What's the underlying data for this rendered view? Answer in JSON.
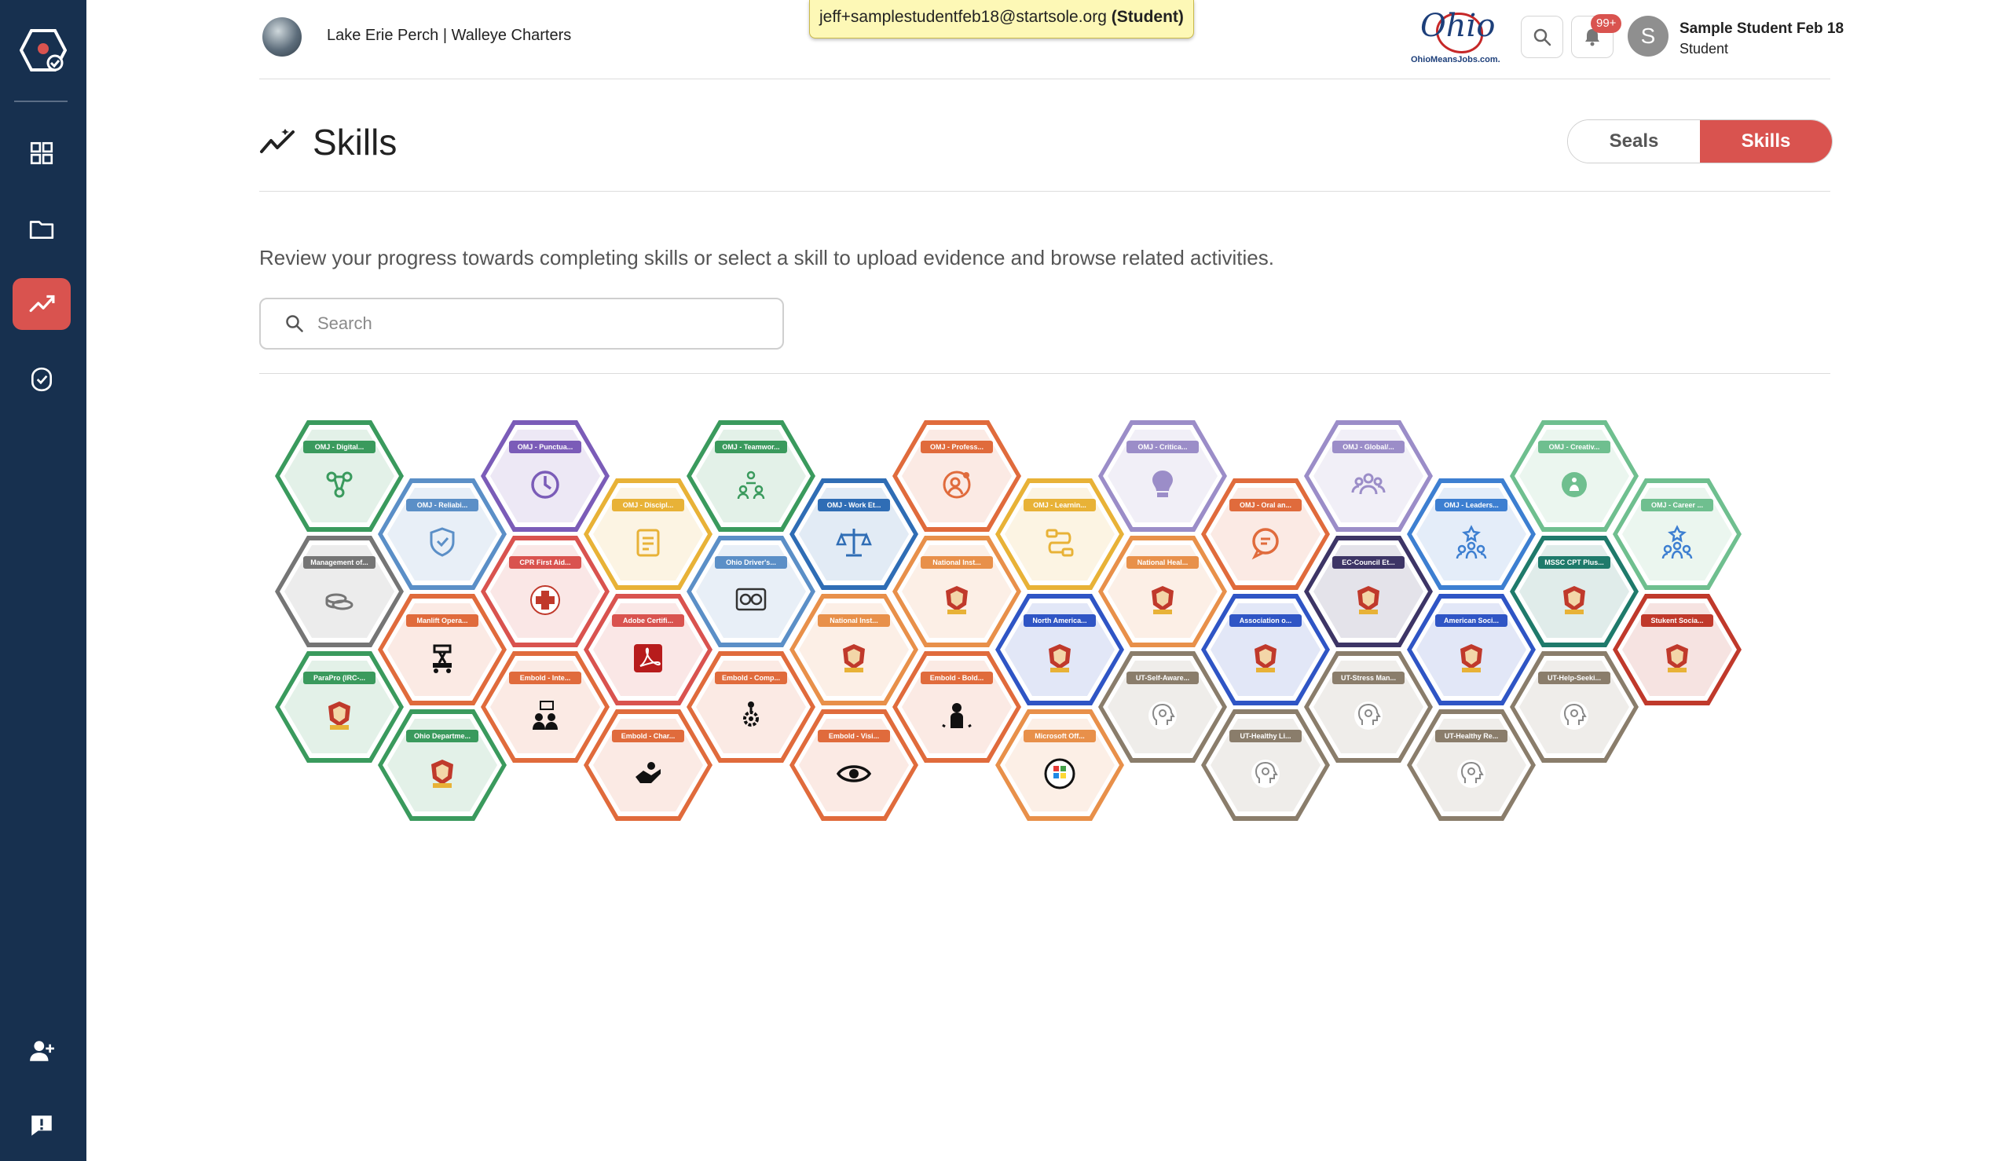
{
  "header": {
    "org_name": "Lake Erie Perch | Walleye Charters",
    "impersonation_email": "jeff+samplestudentfeb18@startsole.org",
    "impersonation_role": "(Student)",
    "ohio_logo_script": "Ohio",
    "ohio_logo_tagline": "OhioMeansJobs.com.",
    "notification_count": "99+",
    "user_initial": "S",
    "user_name": "Sample Student Feb 18",
    "user_role": "Student"
  },
  "page": {
    "title": "Skills",
    "toggle": {
      "seals_label": "Seals",
      "skills_label": "Skills",
      "active": "Skills"
    },
    "intro": "Review your progress towards completing skills or select a skill to upload evidence and browse related activities.",
    "search": {
      "placeholder": "Search",
      "value": ""
    }
  },
  "colors": {
    "accent": "#d9534f",
    "sidebar": "#17304f"
  },
  "skills": [
    {
      "label": "OMJ - Digital...",
      "color": "#3a9a5d",
      "icon": "network-icon",
      "col": 0,
      "row": 0
    },
    {
      "label": "Management of...",
      "color": "#757575",
      "icon": "coins-icon",
      "col": 0,
      "row": 1
    },
    {
      "label": "ParaPro (IRC-...",
      "color": "#3a9a5d",
      "icon": "badge-icon",
      "col": 0,
      "row": 2
    },
    {
      "label": "OMJ - Reliabi...",
      "color": "#5b8fc7",
      "icon": "shield-icon",
      "col": 1,
      "row": 0
    },
    {
      "label": "Manlift Opera...",
      "color": "#e06b3c",
      "icon": "manlift-icon",
      "col": 1,
      "row": 1
    },
    {
      "label": "Ohio Departme...",
      "color": "#3a9a5d",
      "icon": "badge-icon",
      "col": 1,
      "row": 2
    },
    {
      "label": "OMJ - Punctua...",
      "color": "#7b5cb8",
      "icon": "clock-icon",
      "col": 2,
      "row": 0
    },
    {
      "label": "CPR First Aid...",
      "color": "#d9534f",
      "icon": "cpr-icon",
      "col": 2,
      "row": 1
    },
    {
      "label": "Embold - Inte...",
      "color": "#e06b3c",
      "icon": "people-talk-icon",
      "col": 2,
      "row": 2
    },
    {
      "label": "OMJ - Discipl...",
      "color": "#e8b237",
      "icon": "notepad-icon",
      "col": 3,
      "row": 0
    },
    {
      "label": "Adobe Certifi...",
      "color": "#d9534f",
      "icon": "acrobat-icon",
      "col": 3,
      "row": 1
    },
    {
      "label": "Embold - Char...",
      "color": "#e06b3c",
      "icon": "hands-icon",
      "col": 3,
      "row": 2
    },
    {
      "label": "OMJ - Teamwor...",
      "color": "#3a9a5d",
      "icon": "team-icon",
      "col": 4,
      "row": 0
    },
    {
      "label": "Ohio Driver's...",
      "color": "#5b8fc7",
      "icon": "dashboard-icon",
      "col": 4,
      "row": 1
    },
    {
      "label": "Embold - Comp...",
      "color": "#e06b3c",
      "icon": "gears-icon",
      "col": 4,
      "row": 2
    },
    {
      "label": "OMJ - Work Et...",
      "color": "#2f6db5",
      "icon": "scales-icon",
      "col": 5,
      "row": 0
    },
    {
      "label": "National Inst...",
      "color": "#e8904a",
      "icon": "badge-icon",
      "col": 5,
      "row": 1
    },
    {
      "label": "Embold - Visi...",
      "color": "#e06b3c",
      "icon": "eye-icon",
      "col": 5,
      "row": 2
    },
    {
      "label": "OMJ - Profess...",
      "color": "#e06b3c",
      "icon": "professional-icon",
      "col": 6,
      "row": 0
    },
    {
      "label": "National Inst...",
      "color": "#e8904a",
      "icon": "badge-icon",
      "col": 6,
      "row": 1
    },
    {
      "label": "Embold - Bold...",
      "color": "#e06b3c",
      "icon": "bold-icon",
      "col": 6,
      "row": 2
    },
    {
      "label": "OMJ - Learnin...",
      "color": "#e8b237",
      "icon": "path-icon",
      "col": 7,
      "row": 0
    },
    {
      "label": "North America...",
      "color": "#2f55c5",
      "icon": "badge-icon",
      "col": 7,
      "row": 1
    },
    {
      "label": "Microsoft Off...",
      "color": "#e8904a",
      "icon": "microsoft-icon",
      "col": 7,
      "row": 2
    },
    {
      "label": "OMJ - Critica...",
      "color": "#9b8dc8",
      "icon": "lightbulb-icon",
      "col": 8,
      "row": 0
    },
    {
      "label": "National Heal...",
      "color": "#e8904a",
      "icon": "badge-icon",
      "col": 8,
      "row": 1
    },
    {
      "label": "UT-Self-Aware...",
      "color": "#8a7d6b",
      "icon": "head-icon",
      "col": 8,
      "row": 2
    },
    {
      "label": "OMJ - Oral an...",
      "color": "#e06b3c",
      "icon": "speech-icon",
      "col": 9,
      "row": 0
    },
    {
      "label": "Association o...",
      "color": "#2f55c5",
      "icon": "badge-icon",
      "col": 9,
      "row": 1
    },
    {
      "label": "UT-Healthy Li...",
      "color": "#8a7d6b",
      "icon": "head-icon",
      "col": 9,
      "row": 2
    },
    {
      "label": "OMJ - Global/...",
      "color": "#9b8dc8",
      "icon": "global-team-icon",
      "col": 10,
      "row": 0
    },
    {
      "label": "EC-Council Et...",
      "color": "#3d3566",
      "icon": "badge-icon",
      "col": 10,
      "row": 1
    },
    {
      "label": "UT-Stress Man...",
      "color": "#8a7d6b",
      "icon": "head-icon",
      "col": 10,
      "row": 2
    },
    {
      "label": "OMJ - Leaders...",
      "color": "#3d7fd1",
      "icon": "leader-icon",
      "col": 11,
      "row": 0
    },
    {
      "label": "American Soci...",
      "color": "#2f55c5",
      "icon": "badge-icon",
      "col": 11,
      "row": 1
    },
    {
      "label": "UT-Healthy Re...",
      "color": "#8a7d6b",
      "icon": "head-icon",
      "col": 11,
      "row": 2
    },
    {
      "label": "OMJ - Creativ...",
      "color": "#6fbf8f",
      "icon": "creative-icon",
      "col": 12,
      "row": 0
    },
    {
      "label": "MSSC CPT Plus...",
      "color": "#1f7a6b",
      "icon": "badge-icon",
      "col": 12,
      "row": 1
    },
    {
      "label": "UT-Help-Seeki...",
      "color": "#8a7d6b",
      "icon": "head-icon",
      "col": 12,
      "row": 2
    },
    {
      "label": "OMJ - Career ...",
      "color": "#6fbf8f",
      "icon": "career-icon",
      "col": 13,
      "row": 0
    },
    {
      "label": "Stukent Socia...",
      "color": "#c0392b",
      "icon": "badge-icon",
      "col": 13,
      "row": 1
    }
  ]
}
